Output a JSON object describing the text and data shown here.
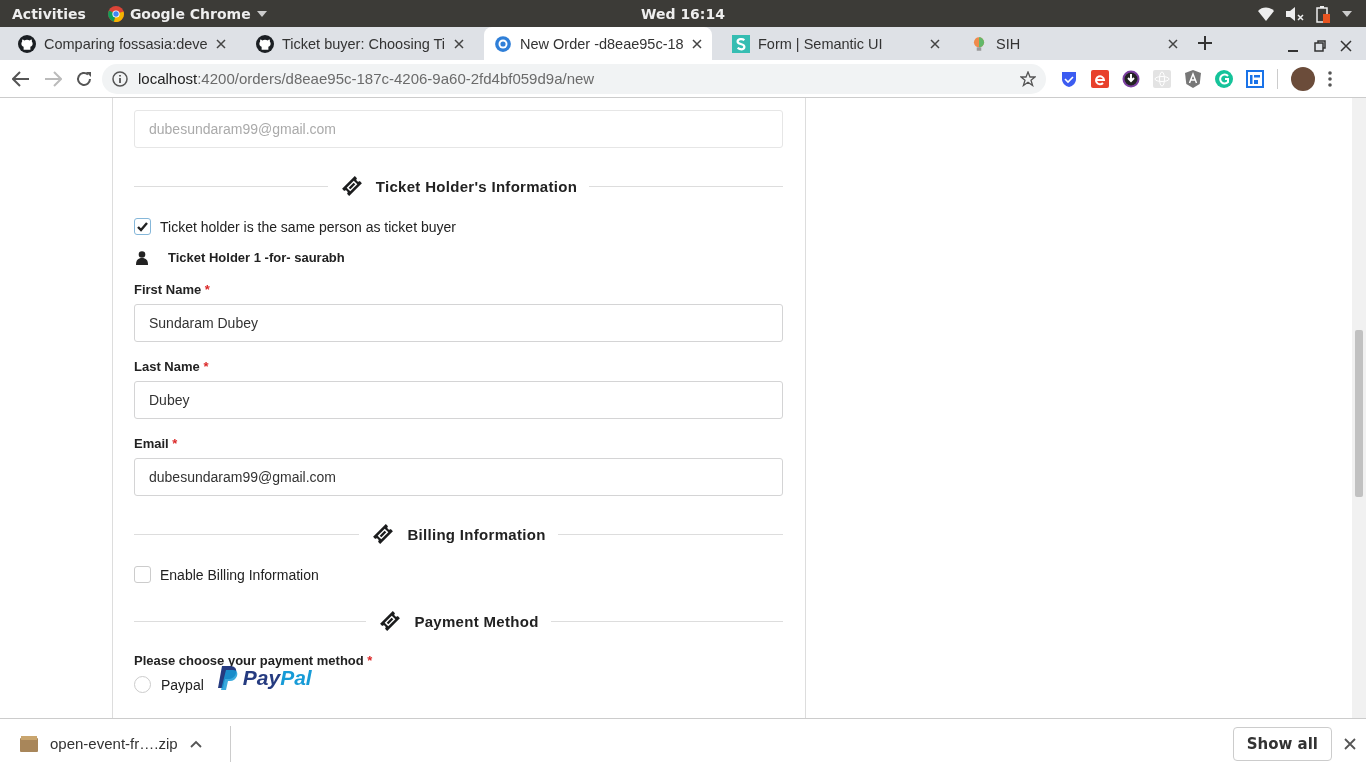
{
  "top_bar": {
    "activities": "Activities",
    "app_name": "Google Chrome",
    "clock": "Wed 16:14"
  },
  "tabs": [
    {
      "title": "Comparing fossasia:deve",
      "kind": "github",
      "selected": false
    },
    {
      "title": "Ticket buyer: Choosing Ti",
      "kind": "github",
      "selected": false
    },
    {
      "title": "New Order -d8eae95c-18",
      "kind": "ring",
      "selected": true
    },
    {
      "title": "Form | Semantic UI",
      "kind": "semantic",
      "selected": false
    },
    {
      "title": "SIH",
      "kind": "bulb",
      "selected": false
    }
  ],
  "address_bar": {
    "host": "localhost",
    "path": ":4200/orders/d8eae95c-187c-4206-9a60-2fd4bf059d9a/new"
  },
  "form": {
    "required_mark": "*",
    "items": [
      {
        "kind": "field",
        "value": "dubesundaram99@gmail.com",
        "disabled": true
      },
      {
        "kind": "divider",
        "title": "Ticket Holder's Information"
      },
      {
        "kind": "checkbox",
        "label": "Ticket holder is the same person as ticket buyer",
        "checked": true
      },
      {
        "kind": "holder",
        "label": "Ticket Holder 1 -for- saurabh"
      },
      {
        "kind": "field",
        "label": "First Name",
        "required": true,
        "value": "Sundaram Dubey",
        "disabled": false
      },
      {
        "kind": "field",
        "label": "Last Name",
        "required": true,
        "value": "Dubey",
        "disabled": false
      },
      {
        "kind": "field",
        "label": "Email",
        "required": true,
        "value": "dubesundaram99@gmail.com",
        "disabled": false
      },
      {
        "kind": "divider",
        "title": "Billing Information"
      },
      {
        "kind": "checkbox",
        "label": "Enable Billing Information",
        "checked": false
      },
      {
        "kind": "divider",
        "title": "Payment Method"
      },
      {
        "kind": "label",
        "label": "Please choose your payment method",
        "required": true
      },
      {
        "kind": "radio",
        "label": "Paypal",
        "selected": false,
        "logo": [
          "Pay",
          "Pal"
        ]
      }
    ]
  },
  "downloads": {
    "file": "open-event-fr….zip",
    "show_all": "Show all"
  }
}
